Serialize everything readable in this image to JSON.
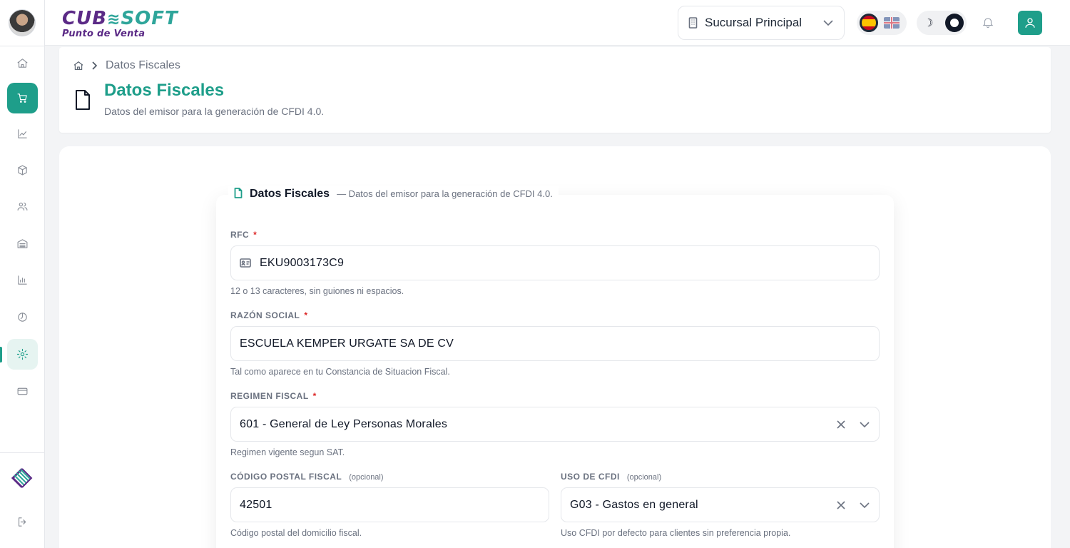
{
  "app": {
    "brand": {
      "part1": "CUB",
      "part2": "SOFT",
      "subtitle": "Punto de Venta"
    }
  },
  "header": {
    "branch_label": "Sucursal Principal",
    "languages": [
      "es",
      "en"
    ],
    "active_language": "es",
    "theme": "light"
  },
  "sidebar": {
    "items": [
      {
        "name": "home",
        "icon": "home-icon"
      },
      {
        "name": "sales",
        "icon": "cart-icon",
        "state": "active"
      },
      {
        "name": "analytics",
        "icon": "trend-chart-icon"
      },
      {
        "name": "products",
        "icon": "box-icon"
      },
      {
        "name": "customers",
        "icon": "users-icon"
      },
      {
        "name": "warehouse",
        "icon": "warehouse-icon"
      },
      {
        "name": "reports",
        "icon": "bar-chart-icon"
      },
      {
        "name": "history",
        "icon": "clock-icon"
      },
      {
        "name": "settings",
        "icon": "gear-icon",
        "state": "selected"
      },
      {
        "name": "billing",
        "icon": "credit-card-icon"
      }
    ]
  },
  "breadcrumb": {
    "current": "Datos Fiscales"
  },
  "page": {
    "title": "Datos Fiscales",
    "subtitle": "Datos del emisor para la generación de CFDI 4.0."
  },
  "section": {
    "title": "Datos Fiscales",
    "subtitle": "— Datos del emisor para la generación de CFDI 4.0."
  },
  "form": {
    "rfc": {
      "label": "RFC",
      "required": "*",
      "value": "EKU9003173C9",
      "help": "12 o 13 caracteres, sin guiones ni espacios."
    },
    "razon_social": {
      "label": "RAZÓN SOCIAL",
      "required": "*",
      "value": "ESCUELA KEMPER URGATE SA DE CV",
      "help": "Tal como aparece en tu Constancia de Situacion Fiscal."
    },
    "regimen_fiscal": {
      "label": "REGIMEN FISCAL",
      "required": "*",
      "value": "601 - General de Ley Personas Morales",
      "help": "Regimen vigente segun SAT."
    },
    "codigo_postal": {
      "label": "CÓDIGO POSTAL FISCAL",
      "optional": "(opcional)",
      "value": "42501",
      "help": "Código postal del domicilio fiscal."
    },
    "uso_cfdi": {
      "label": "USO DE CFDI",
      "optional": "(opcional)",
      "value": "G03 - Gastos en general",
      "help": "Uso CFDI por defecto para clientes sin preferencia propia."
    }
  },
  "colors": {
    "accent": "#1e9e8a",
    "brand_purple": "#5b2a86",
    "required": "#dc2626"
  }
}
